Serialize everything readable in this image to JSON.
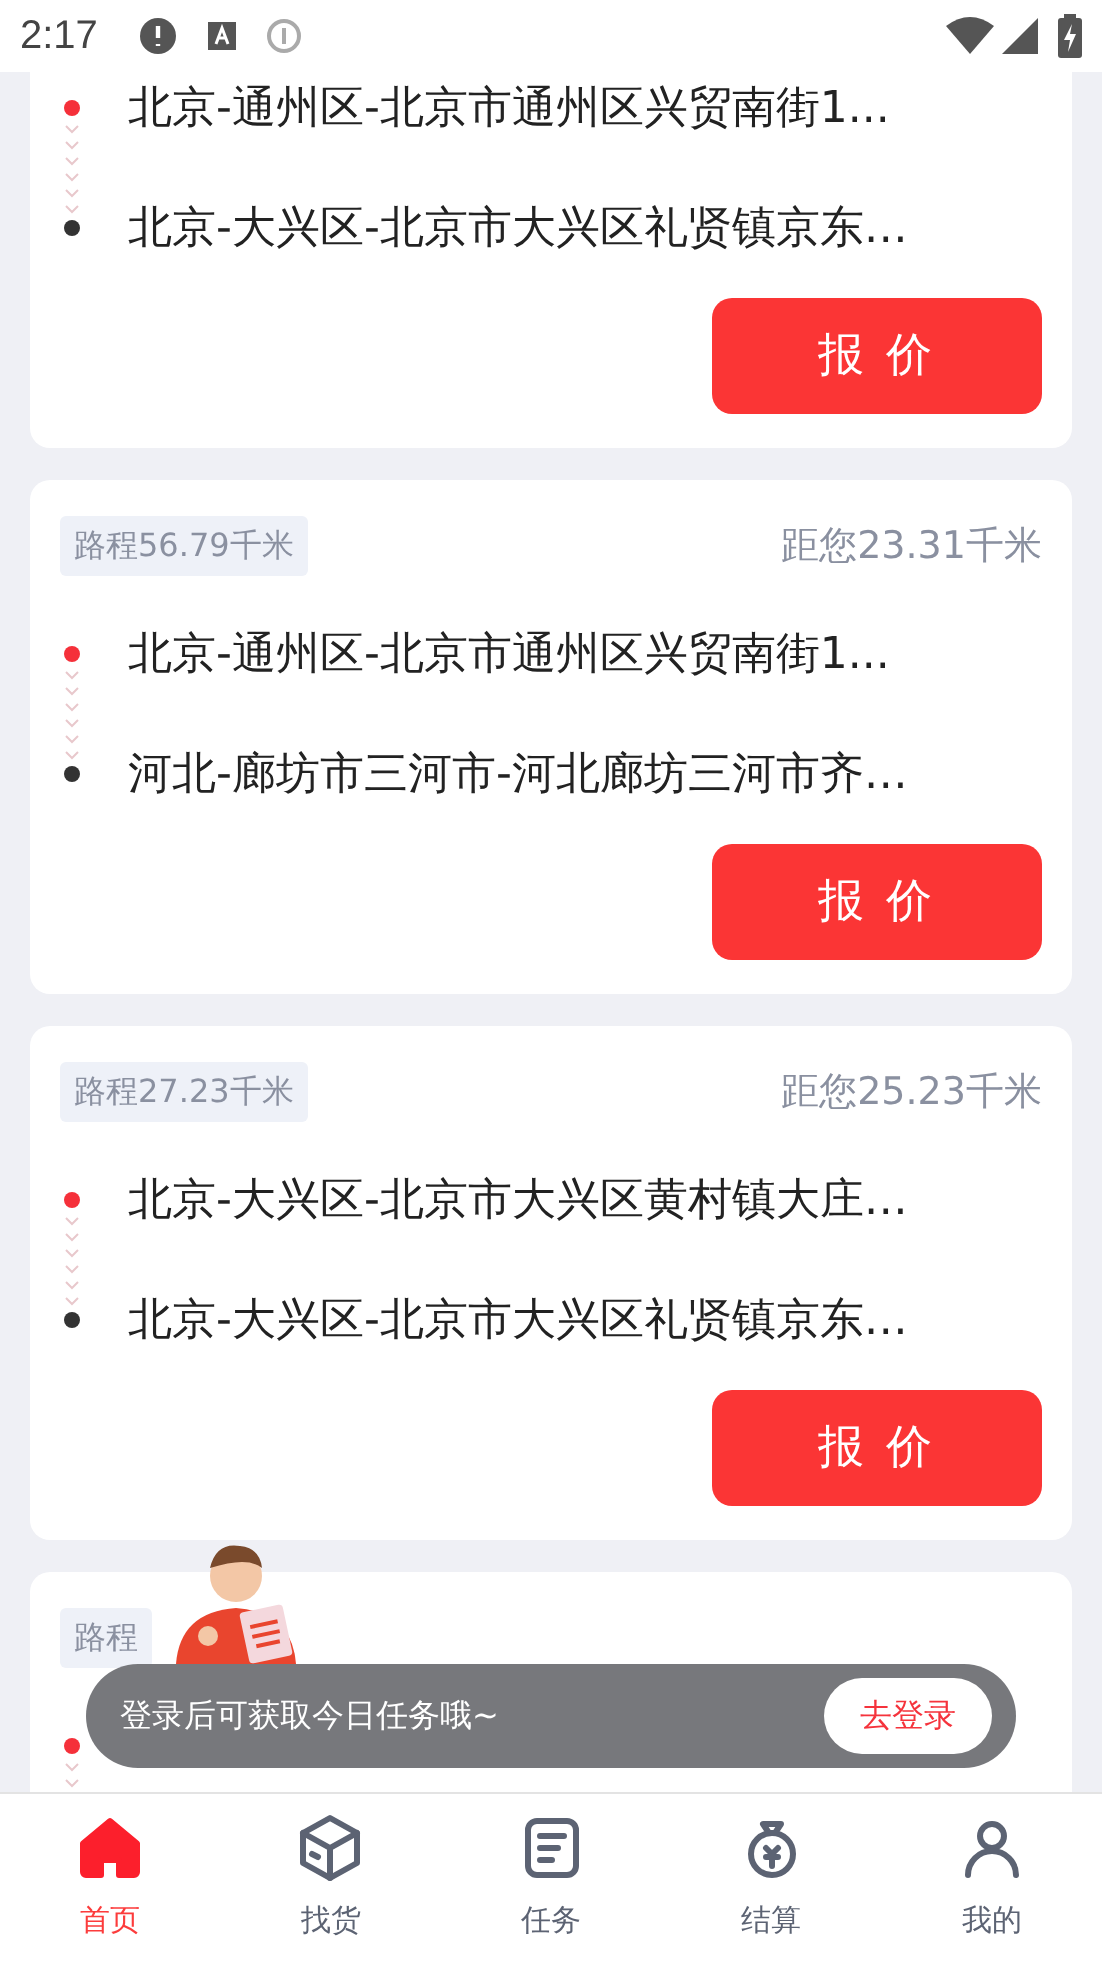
{
  "status_bar": {
    "time": "2:17"
  },
  "orders": [
    {
      "from": "北京-通州区-北京市通州区兴贸南街1...",
      "to": "北京-大兴区-北京市大兴区礼贤镇京东…",
      "button": "报 价"
    },
    {
      "route": "路程56.79千米",
      "distance": "距您23.31千米",
      "from": "北京-通州区-北京市通州区兴贸南街1...",
      "to": "河北-廊坊市三河市-河北廊坊三河市齐…",
      "button": "报 价"
    },
    {
      "route": "路程27.23千米",
      "distance": "距您25.23千米",
      "from": "北京-大兴区-北京市大兴区黄村镇大庄…",
      "to": "北京-大兴区-北京市大兴区礼贤镇京东…",
      "button": "报 价"
    },
    {
      "route": "路程"
    }
  ],
  "login_toast": {
    "message": "登录后可获取今日任务哦~",
    "button": "去登录"
  },
  "tab_bar": [
    {
      "label": "首页",
      "kind": "home",
      "selected": true
    },
    {
      "label": "找货",
      "kind": "box",
      "selected": false
    },
    {
      "label": "任务",
      "kind": "doc",
      "selected": false
    },
    {
      "label": "结算",
      "kind": "bag",
      "selected": false
    },
    {
      "label": "我的",
      "kind": "person",
      "selected": false
    }
  ]
}
